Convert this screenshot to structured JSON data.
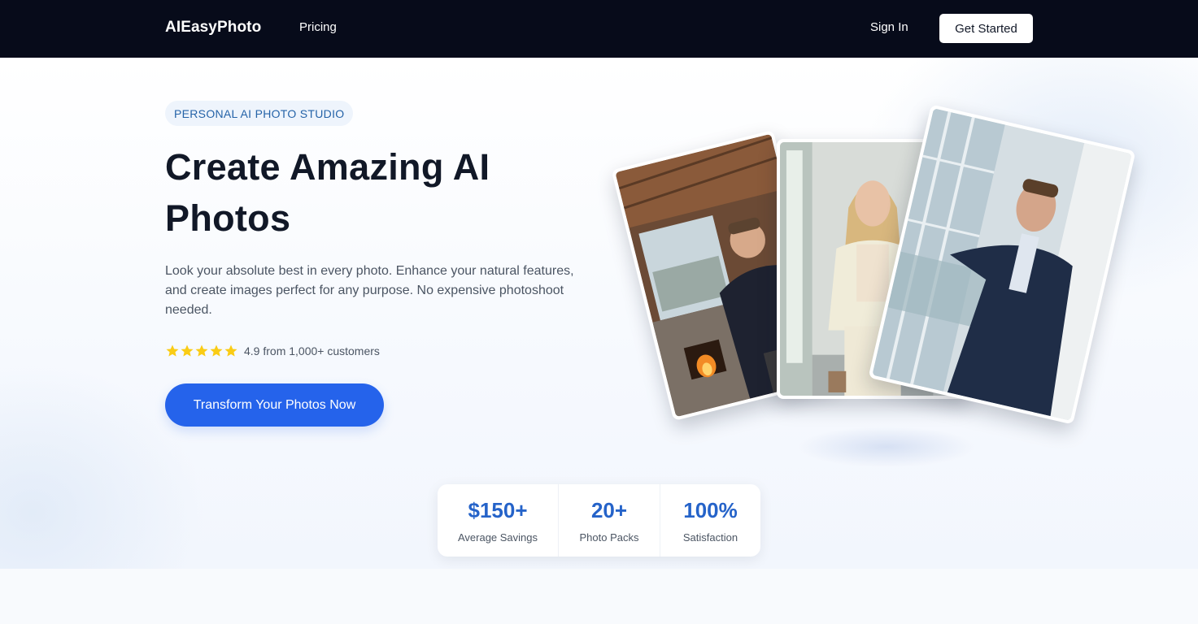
{
  "nav": {
    "brand": "AIEasyPhoto",
    "links": [
      {
        "label": "Pricing"
      }
    ],
    "sign_in": "Sign In",
    "get_started": "Get Started"
  },
  "hero": {
    "tag": "PERSONAL AI PHOTO STUDIO",
    "headline": "Create Amazing AI Photos",
    "subtext": "Look your absolute best in every photo. Enhance your natural features, and create images perfect for any purpose. No expensive photoshoot needed.",
    "rating": {
      "stars": 5,
      "text": "4.9 from 1,000+ customers"
    },
    "cta": "Transform Your Photos Now",
    "photos": [
      {
        "icon": "man-sweater-cabin-photo"
      },
      {
        "icon": "woman-cream-suit-photo"
      },
      {
        "icon": "man-navy-suit-photo"
      }
    ]
  },
  "stats": [
    {
      "value": "$150+",
      "label": "Average Savings"
    },
    {
      "value": "20+",
      "label": "Photo Packs"
    },
    {
      "value": "100%",
      "label": "Satisfaction"
    }
  ],
  "colors": {
    "nav_bg": "#070b1a",
    "accent": "#2563eb",
    "stat_value": "#2563c9",
    "star": "#facc15"
  }
}
